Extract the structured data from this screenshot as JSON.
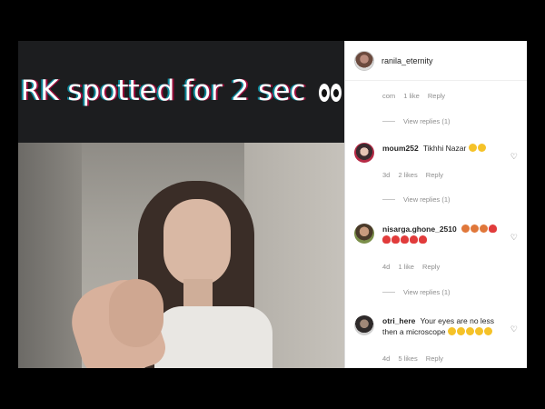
{
  "post": {
    "caption_text": "RK spotted for 2 sec"
  },
  "panel": {
    "username": "ranila_eternity"
  },
  "top_fragment": {
    "meta_prefix": "com",
    "likes": "1 like",
    "reply": "Reply",
    "view_replies": "View replies (1)"
  },
  "comments": [
    {
      "username": "moum252",
      "text": "Tikhhi Nazar",
      "time": "3d",
      "likes": "2 likes",
      "reply": "Reply",
      "view_replies": "View replies (1)"
    },
    {
      "username": "nisarga.ghone_2510",
      "text": "",
      "time": "4d",
      "likes": "1 like",
      "reply": "Reply",
      "view_replies": "View replies (1)"
    },
    {
      "username": "otri_here",
      "text": "Your eyes are no less then a microscope",
      "time": "4d",
      "likes": "5 likes",
      "reply": "Reply"
    }
  ],
  "icons": {
    "heart": "heart-outline-icon"
  },
  "colors": {
    "meta_text": "#8e8e8e",
    "username": "#262626"
  }
}
